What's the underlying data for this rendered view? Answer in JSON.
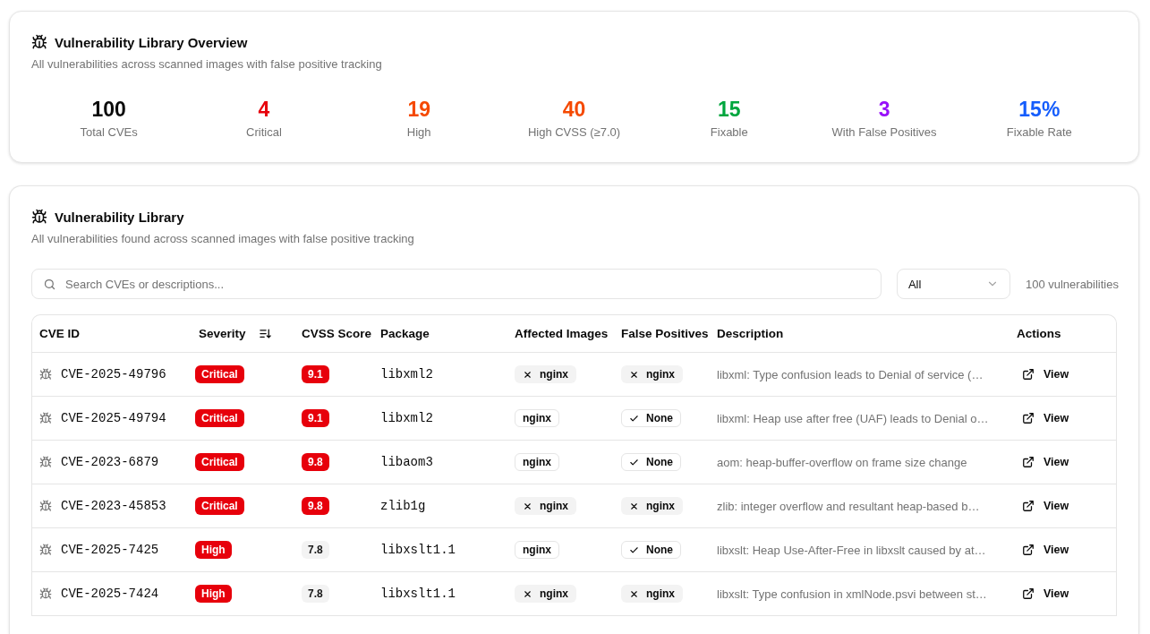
{
  "overview": {
    "title": "Vulnerability Library Overview",
    "subtitle": "All vulnerabilities across scanned images with false positive tracking",
    "stats": [
      {
        "value": "100",
        "label": "Total CVEs",
        "color": "#0a0a0a"
      },
      {
        "value": "4",
        "label": "Critical",
        "color": "#e7000b"
      },
      {
        "value": "19",
        "label": "High",
        "color": "#f54900"
      },
      {
        "value": "40",
        "label": "High CVSS (≥7.0)",
        "color": "#f54900"
      },
      {
        "value": "15",
        "label": "Fixable",
        "color": "#00a63e"
      },
      {
        "value": "3",
        "label": "With False Positives",
        "color": "#9810fa"
      },
      {
        "value": "15%",
        "label": "Fixable Rate",
        "color": "#155dfc"
      }
    ]
  },
  "library": {
    "title": "Vulnerability Library",
    "subtitle": "All vulnerabilities found across scanned images with false positive tracking",
    "search": {
      "placeholder": "Search CVEs or descriptions..."
    },
    "filter": {
      "value": "All"
    },
    "count": "100 vulnerabilities",
    "table": {
      "columns": [
        {
          "label": "CVE ID",
          "sortable": false
        },
        {
          "label": "Severity",
          "sortable": true
        },
        {
          "label": "CVSS Score",
          "sortable": false
        },
        {
          "label": "Package",
          "sortable": false
        },
        {
          "label": "Affected Images",
          "sortable": false
        },
        {
          "label": "False Positives",
          "sortable": false
        },
        {
          "label": "Description",
          "sortable": false
        },
        {
          "label": "Actions",
          "sortable": false
        }
      ],
      "rows": [
        {
          "cve": "CVE-2025-49796",
          "severity": "Critical",
          "score": {
            "label": "9.1",
            "kind": "critical"
          },
          "package": "libxml2",
          "affected_images": [
            {
              "label": "nginx",
              "false_positive": true
            }
          ],
          "false_positives": {
            "label": "nginx",
            "kind": "flagged"
          },
          "description": "libxml: Type confusion leads to Denial of service (…",
          "action": "View"
        },
        {
          "cve": "CVE-2025-49794",
          "severity": "Critical",
          "score": {
            "label": "9.1",
            "kind": "critical"
          },
          "package": "libxml2",
          "affected_images": [
            {
              "label": "nginx",
              "false_positive": false
            }
          ],
          "false_positives": {
            "label": "None",
            "kind": "none"
          },
          "description": "libxml: Heap use after free (UAF) leads to Denial o…",
          "action": "View"
        },
        {
          "cve": "CVE-2023-6879",
          "severity": "Critical",
          "score": {
            "label": "9.8",
            "kind": "critical"
          },
          "package": "libaom3",
          "affected_images": [
            {
              "label": "nginx",
              "false_positive": false
            }
          ],
          "false_positives": {
            "label": "None",
            "kind": "none"
          },
          "description": "aom: heap-buffer-overflow on frame size change",
          "action": "View"
        },
        {
          "cve": "CVE-2023-45853",
          "severity": "Critical",
          "score": {
            "label": "9.8",
            "kind": "critical"
          },
          "package": "zlib1g",
          "affected_images": [
            {
              "label": "nginx",
              "false_positive": true
            }
          ],
          "false_positives": {
            "label": "nginx",
            "kind": "flagged"
          },
          "description": "zlib: integer overflow and resultant heap-based b…",
          "action": "View"
        },
        {
          "cve": "CVE-2025-7425",
          "severity": "High",
          "score": {
            "label": "7.8",
            "kind": "plain"
          },
          "package": "libxslt1.1",
          "affected_images": [
            {
              "label": "nginx",
              "false_positive": false
            }
          ],
          "false_positives": {
            "label": "None",
            "kind": "none"
          },
          "description": "libxslt: Heap Use-After-Free in libxslt caused by at…",
          "action": "View"
        },
        {
          "cve": "CVE-2025-7424",
          "severity": "High",
          "score": {
            "label": "7.8",
            "kind": "plain"
          },
          "package": "libxslt1.1",
          "affected_images": [
            {
              "label": "nginx",
              "false_positive": true
            }
          ],
          "false_positives": {
            "label": "nginx",
            "kind": "flagged"
          },
          "description": "libxslt: Type confusion in xmlNode.psvi between st…",
          "action": "View"
        }
      ]
    }
  }
}
